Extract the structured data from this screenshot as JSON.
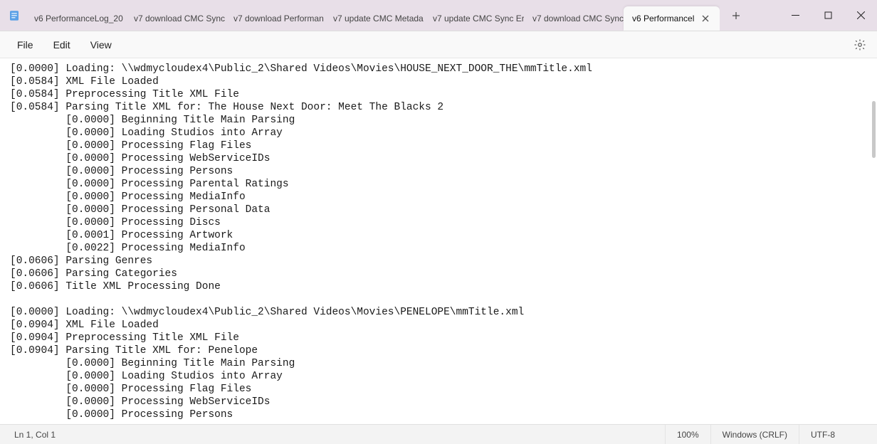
{
  "tabs": [
    {
      "label": "v6 PerformanceLog_20"
    },
    {
      "label": "v7 download CMC Sync"
    },
    {
      "label": "v7 download Performan"
    },
    {
      "label": "v7 update CMC Metada"
    },
    {
      "label": "v7 update CMC Sync Er"
    },
    {
      "label": "v7 download CMC Sync"
    },
    {
      "label": "v6 Performancel",
      "active": true
    }
  ],
  "menu": {
    "file": "File",
    "edit": "Edit",
    "view": "View"
  },
  "content": "[0.0000] Loading: \\\\wdmycloudex4\\Public_2\\Shared Videos\\Movies\\HOUSE_NEXT_DOOR_THE\\mmTitle.xml\n[0.0584] XML File Loaded\n[0.0584] Preprocessing Title XML File\n[0.0584] Parsing Title XML for: The House Next Door: Meet The Blacks 2\n         [0.0000] Beginning Title Main Parsing\n         [0.0000] Loading Studios into Array\n         [0.0000] Processing Flag Files\n         [0.0000] Processing WebServiceIDs\n         [0.0000] Processing Persons\n         [0.0000] Processing Parental Ratings\n         [0.0000] Processing MediaInfo\n         [0.0000] Processing Personal Data\n         [0.0000] Processing Discs\n         [0.0001] Processing Artwork\n         [0.0022] Processing MediaInfo\n[0.0606] Parsing Genres\n[0.0606] Parsing Categories\n[0.0606] Title XML Processing Done\n\n[0.0000] Loading: \\\\wdmycloudex4\\Public_2\\Shared Videos\\Movies\\PENELOPE\\mmTitle.xml\n[0.0904] XML File Loaded\n[0.0904] Preprocessing Title XML File\n[0.0904] Parsing Title XML for: Penelope\n         [0.0000] Beginning Title Main Parsing\n         [0.0000] Loading Studios into Array\n         [0.0000] Processing Flag Files\n         [0.0000] Processing WebServiceIDs\n         [0.0000] Processing Persons",
  "status": {
    "cursor": "Ln 1, Col 1",
    "zoom": "100%",
    "lineend": "Windows (CRLF)",
    "encoding": "UTF-8"
  }
}
